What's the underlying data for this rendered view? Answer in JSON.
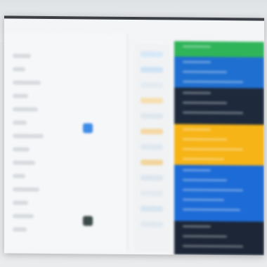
{
  "window": {
    "title": ""
  },
  "left_panel": {
    "rows": [
      {
        "w": 26
      },
      {
        "w": 18
      },
      {
        "w": 40
      },
      {
        "w": 22
      },
      {
        "w": 36
      },
      {
        "w": 20
      },
      {
        "w": 44
      },
      {
        "w": 24
      },
      {
        "w": 32
      },
      {
        "w": 18
      },
      {
        "w": 38
      },
      {
        "w": 22
      },
      {
        "w": 30
      },
      {
        "w": 20
      }
    ],
    "icons": [
      {
        "name": "blue-app-icon",
        "color": "#3f8be8"
      },
      {
        "name": "dark-app-icon",
        "color": "#3c4a4a"
      }
    ]
  },
  "mid_panel": {
    "rows": [
      {
        "color": "#d7e9f7"
      },
      {
        "color": "#cfe3f3"
      },
      {
        "color": "#e4ecf2"
      },
      {
        "color": "#f6dfb0"
      },
      {
        "color": "#dfe7ee"
      },
      {
        "color": "#f4d9a6"
      },
      {
        "color": "#e0e8ef"
      },
      {
        "color": "#f2d59c"
      },
      {
        "color": "#dde6ee"
      },
      {
        "color": "#e3eaf0"
      },
      {
        "color": "#d9e5ef"
      },
      {
        "color": "#e2e9ef"
      }
    ]
  },
  "right_panel": {
    "bands": [
      {
        "name": "green-band",
        "color": "#2fb459",
        "h": 22
      },
      {
        "name": "blue-band",
        "color": "#1f6fd0",
        "h": 44
      },
      {
        "name": "navy-band",
        "color": "#1e2a3c",
        "h": 52
      },
      {
        "name": "yellow-band",
        "color": "#f6b417",
        "h": 58
      },
      {
        "name": "blue-band-lower",
        "color": "#1d6bd6",
        "h": 80
      },
      {
        "name": "navy-band-lower",
        "color": "#1c2636",
        "h": 48
      }
    ]
  }
}
